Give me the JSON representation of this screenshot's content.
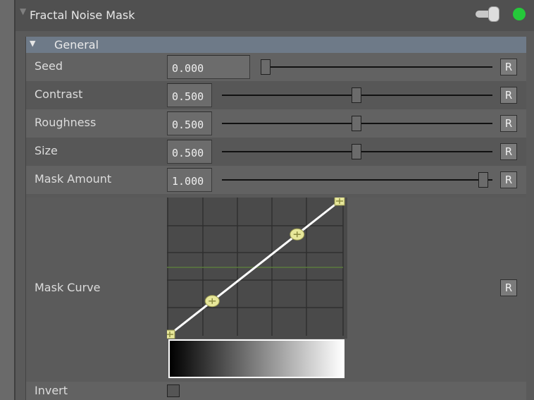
{
  "header": {
    "title": "Fractal Noise Mask",
    "toggle_state": "on",
    "status_color": "#25c93a"
  },
  "section": {
    "title": "General"
  },
  "params": [
    {
      "label": "Seed",
      "value": "0.000",
      "slider_fraction": 0.0,
      "reset": "R"
    },
    {
      "label": "Contrast",
      "value": "0.500",
      "slider_fraction": 0.5,
      "reset": "R"
    },
    {
      "label": "Roughness",
      "value": "0.500",
      "slider_fraction": 0.5,
      "reset": "R"
    },
    {
      "label": "Size",
      "value": "0.500",
      "slider_fraction": 0.5,
      "reset": "R"
    },
    {
      "label": "Mask Amount",
      "value": "1.000",
      "slider_fraction": 1.0,
      "reset": "R"
    }
  ],
  "curve": {
    "label": "Mask Curve",
    "reset": "R",
    "points": [
      [
        0,
        0
      ],
      [
        0.25,
        0.25
      ],
      [
        0.75,
        0.75
      ],
      [
        1,
        1
      ]
    ]
  },
  "invert": {
    "label": "Invert",
    "checked": false
  }
}
